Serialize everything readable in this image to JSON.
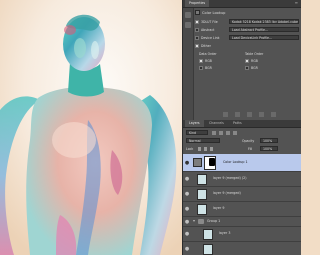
{
  "properties": {
    "tabs": [
      "Properties"
    ],
    "title": "Color Lookup",
    "rows": [
      {
        "label": "3DLUT File",
        "value": "Kodak 5218 Kodak 2383 (by Adobe).cube",
        "checked": true
      },
      {
        "label": "Abstract",
        "value": "Load Abstract Profile...",
        "checked": false
      },
      {
        "label": "Device Link",
        "value": "Load DeviceLink Profile...",
        "checked": false
      }
    ],
    "dither_label": "Dither",
    "data_order_label": "Data Order",
    "table_order_label": "Table Order",
    "rgb_label": "RGB",
    "bgr_label": "BGR"
  },
  "layers_panel": {
    "tabs": [
      "Layers",
      "Channels",
      "Paths"
    ],
    "kind_label": "Kind",
    "blend_mode": "Normal",
    "opacity_label": "Opacity",
    "opacity_value": "100%",
    "lock_label": "Lock",
    "fill_label": "Fill",
    "fill_value": "100%",
    "layers": [
      {
        "name": "Color Lookup 1",
        "selected": true
      },
      {
        "name": "layer 9 (merged) (2)",
        "selected": false
      },
      {
        "name": "layer 9 (merged)",
        "selected": false
      },
      {
        "name": "layer 9",
        "selected": false
      },
      {
        "name": "Group 1",
        "selected": false
      },
      {
        "name": "layer 3",
        "selected": false
      }
    ]
  },
  "colors": {
    "panel_bg": "#535353",
    "tabbar_bg": "#3b3b3b",
    "selection": "#b9c9ec",
    "canvas_bg": "#f2ddc6"
  }
}
